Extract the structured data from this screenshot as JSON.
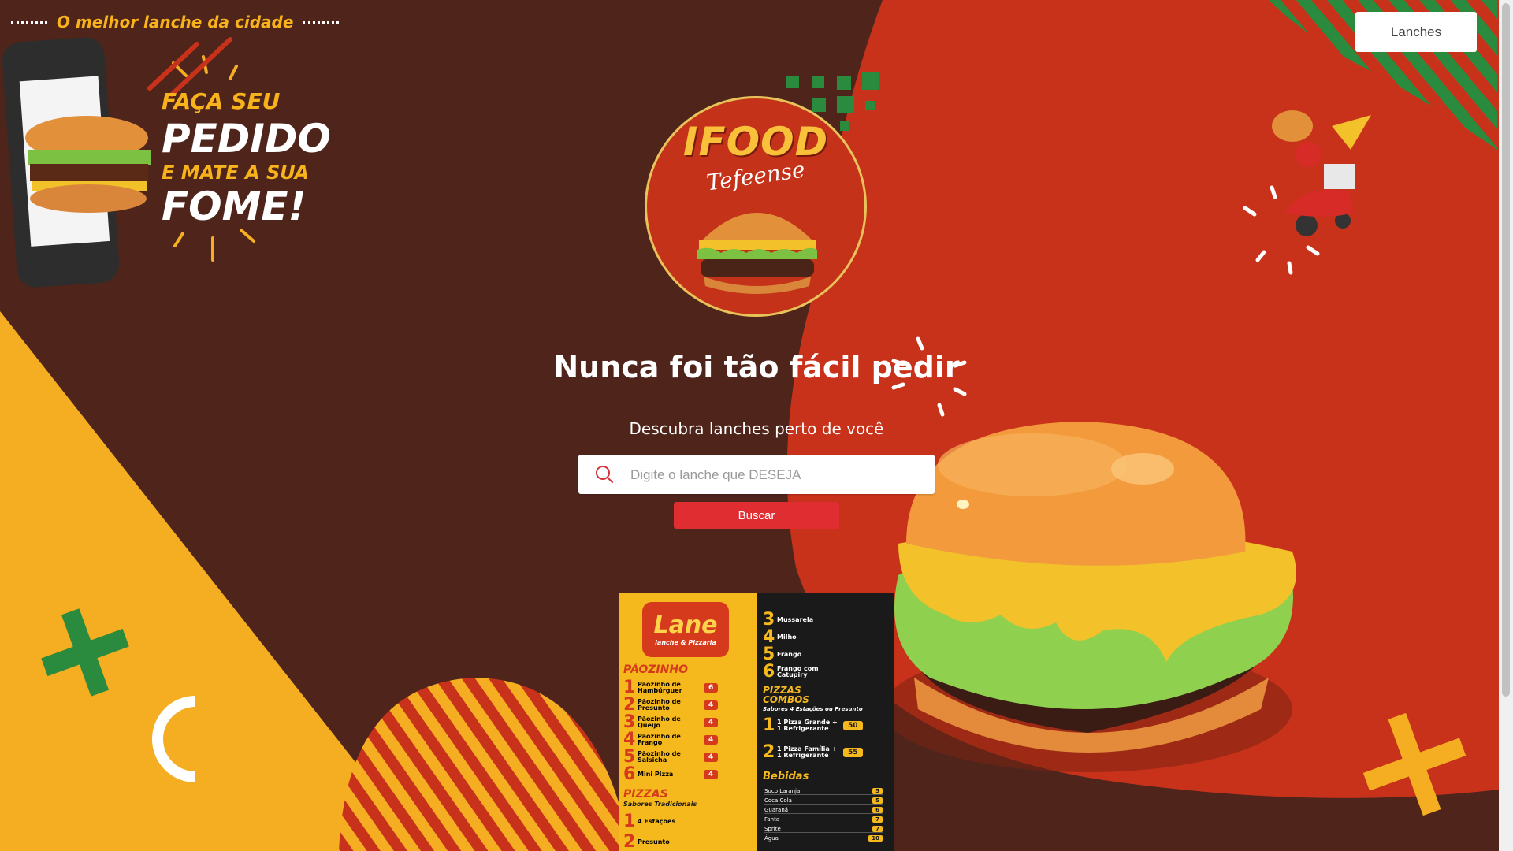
{
  "nav": {
    "lanches_button": "Lanches"
  },
  "tagline": "O melhor lanche da cidade",
  "promo": {
    "line1": "FAÇA SEU",
    "line2": "PEDIDO",
    "line3": "E MATE A SUA",
    "line4": "FOME!"
  },
  "logo": {
    "title": "IFOOD",
    "subtitle": "Tefeense"
  },
  "hero": {
    "headline": "Nunca foi tão fácil pedir",
    "subheadline": "Descubra lanches perto de você"
  },
  "search": {
    "placeholder": "Digite o lanche que DESEJA",
    "value": "",
    "button_label": "Buscar"
  },
  "menu_poster": {
    "brand": "Lane",
    "brand_sub": "lanche & Pizzaria",
    "section_paozinho": "PÃOZINHO",
    "paozinho": [
      {
        "num": "1",
        "name": "Pãozinho de Hambúrguer",
        "price": "6"
      },
      {
        "num": "2",
        "name": "Pãozinho de Presunto",
        "price": "4"
      },
      {
        "num": "3",
        "name": "Pãozinho de Queijo",
        "price": "4"
      },
      {
        "num": "4",
        "name": "Pãozinho de Frango",
        "price": "4"
      },
      {
        "num": "5",
        "name": "Pãozinho de Salsicha",
        "price": "4"
      },
      {
        "num": "6",
        "name": "Mini Pizza",
        "price": "4"
      }
    ],
    "section_pizzas": "PIZZAS",
    "pizzas_sub": "Sabores Tradicionais",
    "pizzas_left": [
      {
        "num": "1",
        "name": "4 Estações"
      },
      {
        "num": "2",
        "name": "Presunto"
      }
    ],
    "flavors_right": [
      {
        "num": "3",
        "name": "Mussarela"
      },
      {
        "num": "4",
        "name": "Milho"
      },
      {
        "num": "5",
        "name": "Frango"
      },
      {
        "num": "6",
        "name": "Frango com Catupiry"
      }
    ],
    "section_combos": "PIZZAS COMBOS",
    "combos_sub": "Sabores 4 Estações ou Presunto",
    "combos": [
      {
        "num": "1",
        "name": "1 Pizza Grande + 1 Refrigerante",
        "price": "50"
      },
      {
        "num": "2",
        "name": "1 Pizza Família + 1 Refrigerante",
        "price": "55"
      }
    ],
    "section_bebidas": "Bebidas",
    "bebidas": [
      {
        "name": "Suco Laranja",
        "price": "5"
      },
      {
        "name": "Coca Cola",
        "price": "5"
      },
      {
        "name": "Guaraná",
        "price": "6"
      },
      {
        "name": "Fanta",
        "price": "7"
      },
      {
        "name": "Sprite",
        "price": "7"
      },
      {
        "name": "Água",
        "price": "10"
      }
    ]
  },
  "colors": {
    "background": "#4f251b",
    "red": "#c9321a",
    "yellow": "#f5ae22",
    "green": "#2a8a3e",
    "button": "#df2d32"
  }
}
